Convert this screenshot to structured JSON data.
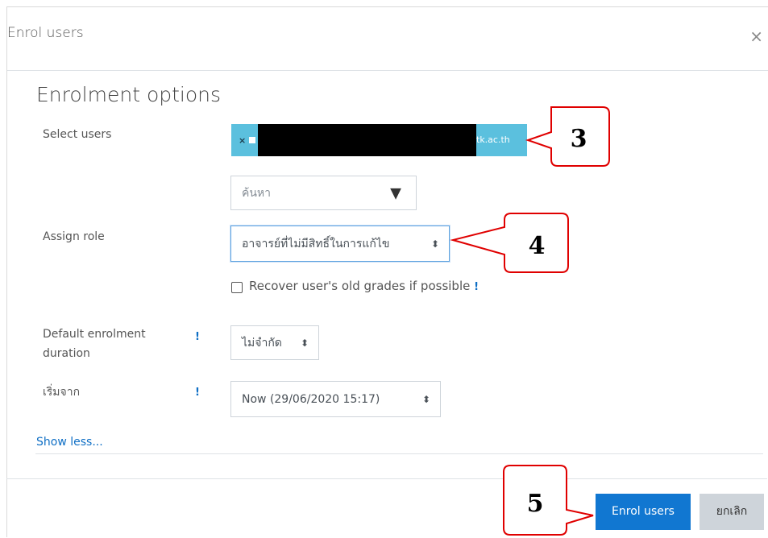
{
  "dialog": {
    "title": "Enrol users",
    "close_glyph": "×"
  },
  "form": {
    "heading": "Enrolment options",
    "select_users_label": "Select users",
    "selected_user": {
      "remove_glyph": "×",
      "visible_suffix": "tk.ac.th"
    },
    "search": {
      "placeholder": "ค้นหา",
      "arrow": "▼"
    },
    "assign_role_label": "Assign role",
    "assign_role_value": "อาจารย์ที่ไม่มีสิทธิ์ในการแก้ไข",
    "recover_grades_label": "Recover user's old grades if possible",
    "recover_grades_checked": false,
    "duration_label_line1": "Default enrolment",
    "duration_label_line2": "duration",
    "duration_value": "ไม่จำกัด",
    "start_label": "เริ่มจาก",
    "start_value": "Now (29/06/2020 15:17)",
    "help_glyph": "!",
    "select_arrow": "⬍",
    "show_less": "Show less..."
  },
  "footer": {
    "enrol_button": "Enrol users",
    "cancel_button": "ยกเลิก"
  },
  "callouts": {
    "step3": "3",
    "step4": "4",
    "step5": "5",
    "color": "#e00000"
  }
}
